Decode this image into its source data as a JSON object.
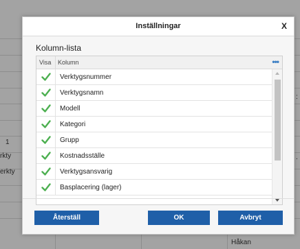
{
  "background": {
    "texts": [
      "1",
      "rkty",
      "erkty",
      "Håkan"
    ],
    "right_marks": [
      ":",
      "."
    ]
  },
  "dialog": {
    "title": "Inställningar",
    "close_label": "X",
    "list_title": "Kolumn-lista",
    "columns": {
      "visa": "Visa",
      "kolumn": "Kolumn",
      "more": "•••"
    },
    "items": [
      {
        "label": "Verktygsnummer",
        "checked": true
      },
      {
        "label": "Verktygsnamn",
        "checked": true
      },
      {
        "label": "Modell",
        "checked": true
      },
      {
        "label": "Kategori",
        "checked": true
      },
      {
        "label": "Grupp",
        "checked": true
      },
      {
        "label": "Kostnadsställe",
        "checked": true
      },
      {
        "label": "Verktygsansvarig",
        "checked": true
      },
      {
        "label": "Basplacering (lager)",
        "checked": true
      }
    ],
    "buttons": {
      "reset": "Återställ",
      "ok": "OK",
      "cancel": "Avbryt"
    },
    "colors": {
      "button": "#1f5fa8",
      "check": "#4caf50",
      "more": "#3b7fc4"
    }
  }
}
